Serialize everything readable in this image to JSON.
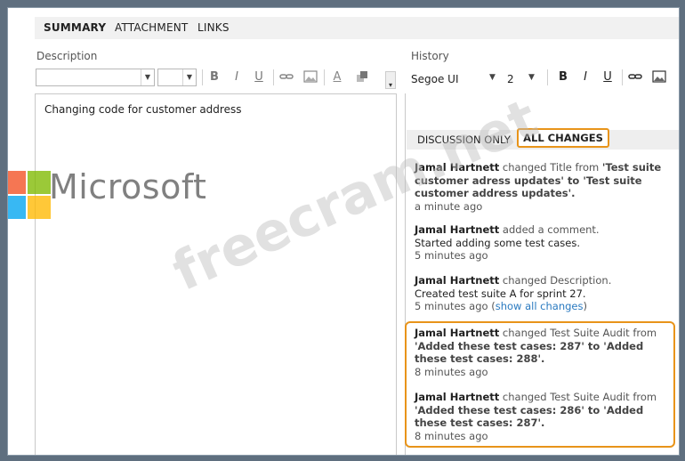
{
  "tabs": [
    "SUMMARY",
    "ATTACHMENT",
    "LINKS"
  ],
  "description": {
    "label": "Description",
    "text": "Changing code for customer address"
  },
  "history": {
    "label": "History",
    "font": "Segoe UI",
    "size": "2",
    "subtabs": {
      "discussion": "DISCUSSION ONLY",
      "all": "ALL CHANGES"
    },
    "entries": [
      {
        "who": "Jamal Hartnett",
        "action": " changed Title from ",
        "text": "'Test suite customer adress updates' to 'Test suite customer address updates'.",
        "time": "a minute ago"
      },
      {
        "who": "Jamal Hartnett",
        "action": " added a comment.",
        "text": "Started adding some test cases.",
        "time": "5 minutes ago"
      },
      {
        "who": "Jamal Hartnett",
        "action": " changed Description.",
        "text": "Created test suite A for sprint 27.",
        "time": "5 minutes ago (",
        "link": "show all changes",
        "time_end": ")"
      },
      {
        "who": "Jamal Hartnett",
        "action": " changed Test Suite Audit from ",
        "text": "'Added these test cases: 287' to 'Added these test cases: 288'.",
        "time": "8 minutes ago"
      },
      {
        "who": "Jamal Hartnett",
        "action": " changed Test Suite Audit from ",
        "text": "'Added these test cases: 286' to 'Added these test cases: 287'.",
        "time": "8 minutes ago"
      }
    ]
  },
  "toolbar_icons": [
    "bold-icon",
    "italic-icon",
    "underline-icon",
    "link-icon",
    "image-icon",
    "font-color-icon",
    "highlight-icon"
  ],
  "watermark": {
    "brand": "Microsoft",
    "site": "freecram.net"
  },
  "colors": {
    "highlight": "#e8941a",
    "link": "#2a7ac0",
    "tabbar": "#f1f1f1"
  }
}
